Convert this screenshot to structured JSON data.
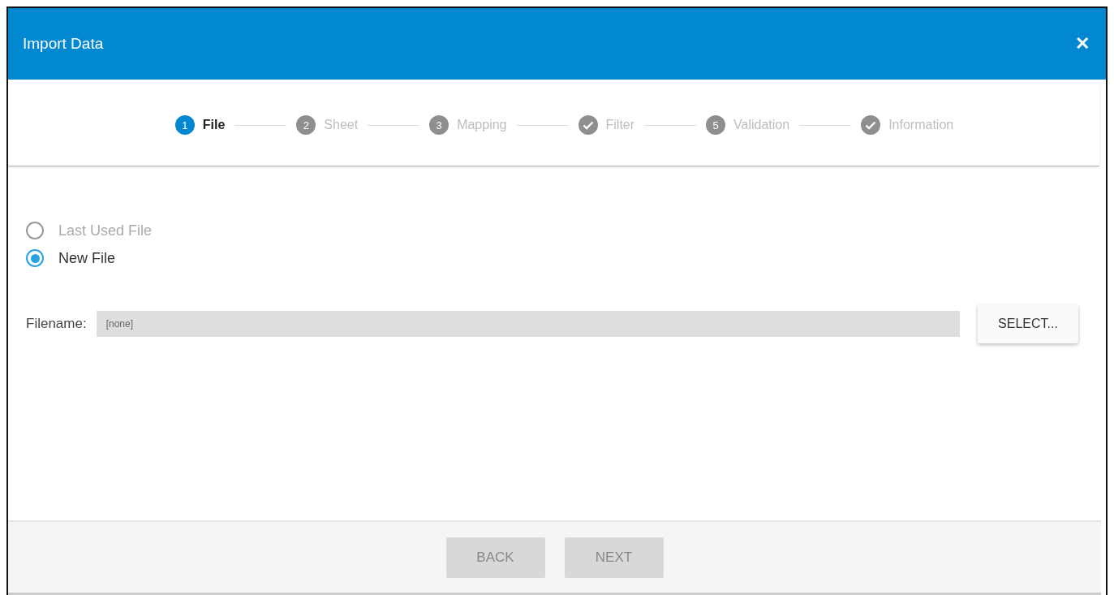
{
  "window": {
    "title": "Import Data",
    "close": "✕"
  },
  "steps": [
    {
      "label": "File",
      "kind": "number",
      "marker": "1",
      "selected": true
    },
    {
      "label": "Sheet",
      "kind": "number",
      "marker": "2",
      "selected": false
    },
    {
      "label": "Mapping",
      "kind": "number",
      "marker": "3",
      "selected": false
    },
    {
      "label": "Filter",
      "kind": "check",
      "selected": false
    },
    {
      "label": "Validation",
      "kind": "number",
      "marker": "5",
      "selected": false
    },
    {
      "label": "Information",
      "kind": "check",
      "selected": false
    }
  ],
  "source_options": [
    {
      "label": "Last Used File",
      "selected": false,
      "disabled": true
    },
    {
      "label": "New File",
      "selected": true,
      "disabled": false
    }
  ],
  "filename": {
    "label": "Filename:",
    "value": "[none]"
  },
  "select_button": "SELECT...",
  "footer_buttons": [
    {
      "label": "BACK",
      "disabled": true
    },
    {
      "label": "NEXT",
      "disabled": true
    }
  ]
}
